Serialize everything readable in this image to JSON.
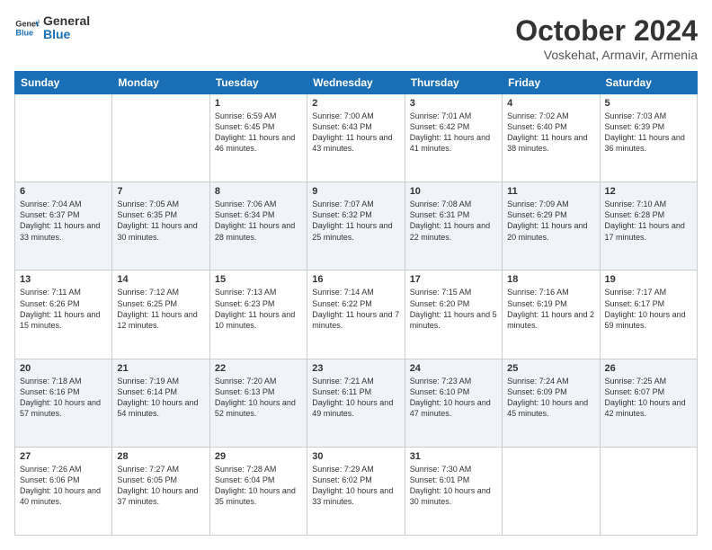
{
  "header": {
    "logo": {
      "line1": "General",
      "line2": "Blue"
    },
    "title": "October 2024",
    "location": "Voskehat, Armavir, Armenia"
  },
  "weekdays": [
    "Sunday",
    "Monday",
    "Tuesday",
    "Wednesday",
    "Thursday",
    "Friday",
    "Saturday"
  ],
  "weeks": [
    [
      {
        "day": "",
        "info": ""
      },
      {
        "day": "",
        "info": ""
      },
      {
        "day": "1",
        "info": "Sunrise: 6:59 AM\nSunset: 6:45 PM\nDaylight: 11 hours and 46 minutes."
      },
      {
        "day": "2",
        "info": "Sunrise: 7:00 AM\nSunset: 6:43 PM\nDaylight: 11 hours and 43 minutes."
      },
      {
        "day": "3",
        "info": "Sunrise: 7:01 AM\nSunset: 6:42 PM\nDaylight: 11 hours and 41 minutes."
      },
      {
        "day": "4",
        "info": "Sunrise: 7:02 AM\nSunset: 6:40 PM\nDaylight: 11 hours and 38 minutes."
      },
      {
        "day": "5",
        "info": "Sunrise: 7:03 AM\nSunset: 6:39 PM\nDaylight: 11 hours and 36 minutes."
      }
    ],
    [
      {
        "day": "6",
        "info": "Sunrise: 7:04 AM\nSunset: 6:37 PM\nDaylight: 11 hours and 33 minutes."
      },
      {
        "day": "7",
        "info": "Sunrise: 7:05 AM\nSunset: 6:35 PM\nDaylight: 11 hours and 30 minutes."
      },
      {
        "day": "8",
        "info": "Sunrise: 7:06 AM\nSunset: 6:34 PM\nDaylight: 11 hours and 28 minutes."
      },
      {
        "day": "9",
        "info": "Sunrise: 7:07 AM\nSunset: 6:32 PM\nDaylight: 11 hours and 25 minutes."
      },
      {
        "day": "10",
        "info": "Sunrise: 7:08 AM\nSunset: 6:31 PM\nDaylight: 11 hours and 22 minutes."
      },
      {
        "day": "11",
        "info": "Sunrise: 7:09 AM\nSunset: 6:29 PM\nDaylight: 11 hours and 20 minutes."
      },
      {
        "day": "12",
        "info": "Sunrise: 7:10 AM\nSunset: 6:28 PM\nDaylight: 11 hours and 17 minutes."
      }
    ],
    [
      {
        "day": "13",
        "info": "Sunrise: 7:11 AM\nSunset: 6:26 PM\nDaylight: 11 hours and 15 minutes."
      },
      {
        "day": "14",
        "info": "Sunrise: 7:12 AM\nSunset: 6:25 PM\nDaylight: 11 hours and 12 minutes."
      },
      {
        "day": "15",
        "info": "Sunrise: 7:13 AM\nSunset: 6:23 PM\nDaylight: 11 hours and 10 minutes."
      },
      {
        "day": "16",
        "info": "Sunrise: 7:14 AM\nSunset: 6:22 PM\nDaylight: 11 hours and 7 minutes."
      },
      {
        "day": "17",
        "info": "Sunrise: 7:15 AM\nSunset: 6:20 PM\nDaylight: 11 hours and 5 minutes."
      },
      {
        "day": "18",
        "info": "Sunrise: 7:16 AM\nSunset: 6:19 PM\nDaylight: 11 hours and 2 minutes."
      },
      {
        "day": "19",
        "info": "Sunrise: 7:17 AM\nSunset: 6:17 PM\nDaylight: 10 hours and 59 minutes."
      }
    ],
    [
      {
        "day": "20",
        "info": "Sunrise: 7:18 AM\nSunset: 6:16 PM\nDaylight: 10 hours and 57 minutes."
      },
      {
        "day": "21",
        "info": "Sunrise: 7:19 AM\nSunset: 6:14 PM\nDaylight: 10 hours and 54 minutes."
      },
      {
        "day": "22",
        "info": "Sunrise: 7:20 AM\nSunset: 6:13 PM\nDaylight: 10 hours and 52 minutes."
      },
      {
        "day": "23",
        "info": "Sunrise: 7:21 AM\nSunset: 6:11 PM\nDaylight: 10 hours and 49 minutes."
      },
      {
        "day": "24",
        "info": "Sunrise: 7:23 AM\nSunset: 6:10 PM\nDaylight: 10 hours and 47 minutes."
      },
      {
        "day": "25",
        "info": "Sunrise: 7:24 AM\nSunset: 6:09 PM\nDaylight: 10 hours and 45 minutes."
      },
      {
        "day": "26",
        "info": "Sunrise: 7:25 AM\nSunset: 6:07 PM\nDaylight: 10 hours and 42 minutes."
      }
    ],
    [
      {
        "day": "27",
        "info": "Sunrise: 7:26 AM\nSunset: 6:06 PM\nDaylight: 10 hours and 40 minutes."
      },
      {
        "day": "28",
        "info": "Sunrise: 7:27 AM\nSunset: 6:05 PM\nDaylight: 10 hours and 37 minutes."
      },
      {
        "day": "29",
        "info": "Sunrise: 7:28 AM\nSunset: 6:04 PM\nDaylight: 10 hours and 35 minutes."
      },
      {
        "day": "30",
        "info": "Sunrise: 7:29 AM\nSunset: 6:02 PM\nDaylight: 10 hours and 33 minutes."
      },
      {
        "day": "31",
        "info": "Sunrise: 7:30 AM\nSunset: 6:01 PM\nDaylight: 10 hours and 30 minutes."
      },
      {
        "day": "",
        "info": ""
      },
      {
        "day": "",
        "info": ""
      }
    ]
  ]
}
